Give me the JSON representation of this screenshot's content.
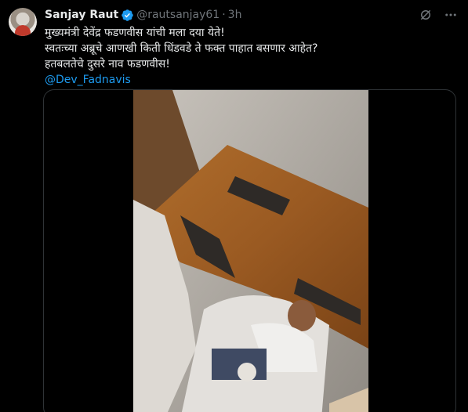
{
  "tweet": {
    "author_name": "Sanjay Raut",
    "handle": "@rautsanjay61",
    "separator": "·",
    "time": "3h",
    "lines": [
      "मुख्यमंत्री देवेंद्र फडणवीस यांची मला दया येते!",
      "स्वतःच्या अब्रूचे आणखी किती धिंडवडे ते फक्त पाहात बसणार आहेत?",
      "हतबलतेचे दुसरे नाव फडणवीस!"
    ],
    "mention": "@Dev_Fadnavis"
  },
  "icons": {
    "verified": "verified-badge-icon",
    "grok": "grok-icon",
    "more": "more-dots-icon"
  },
  "colors": {
    "background": "#000000",
    "text": "#e7e9ea",
    "muted": "#71767b",
    "link": "#1d9bf0",
    "verified": "#1d9bf0"
  }
}
